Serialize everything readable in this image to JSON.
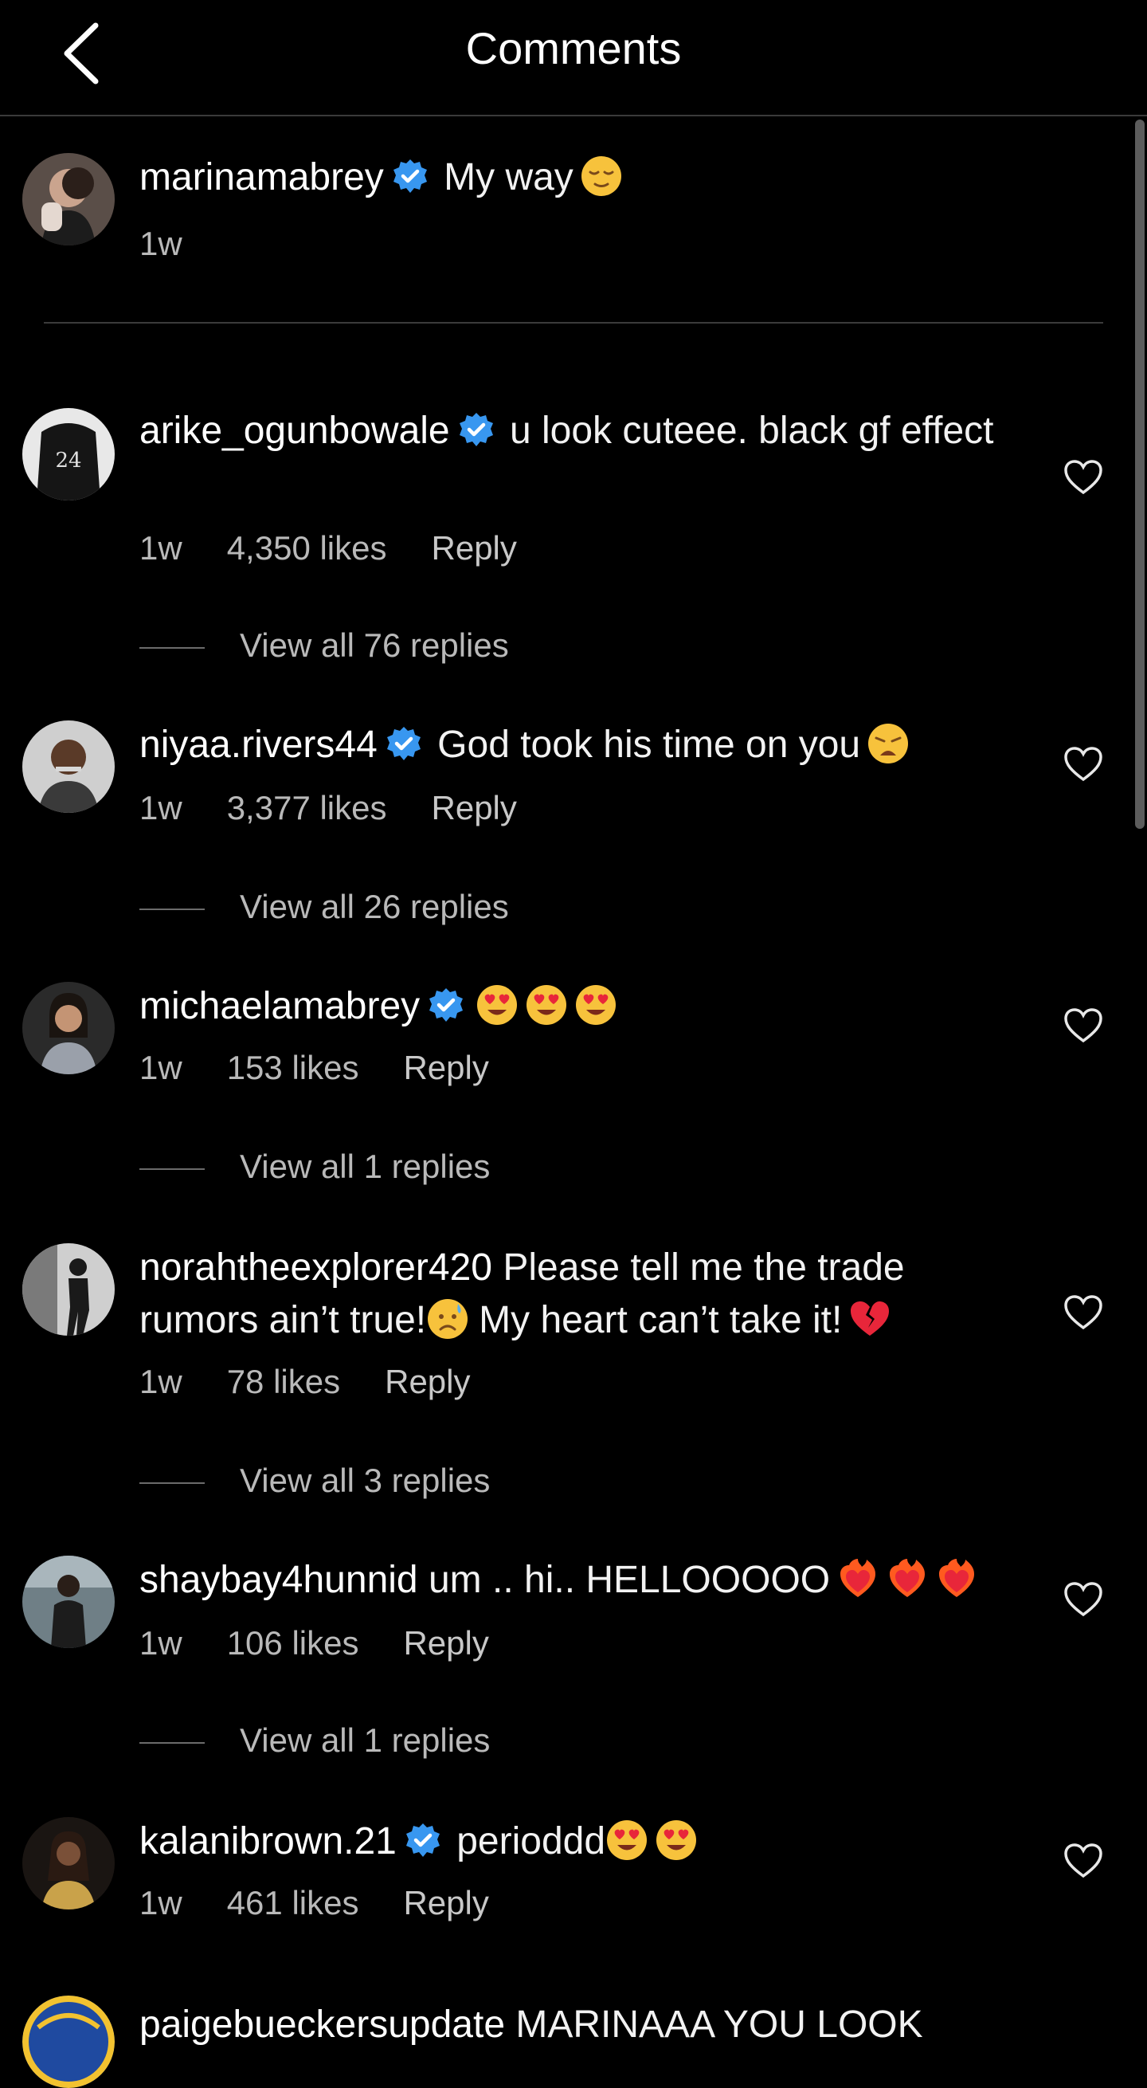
{
  "header": {
    "title": "Comments",
    "back_icon": "chevron-left-icon"
  },
  "caption": {
    "username": "marinamabrey",
    "text": "My way",
    "time": "1w"
  },
  "comments": [
    {
      "username": "arike_ogunbowale",
      "verified": true,
      "text": "u look cuteee. black gf effect",
      "time": "1w",
      "likes": "4,350 likes",
      "reply": "Reply",
      "view_replies": "View all 76 replies",
      "avatar_jersey": "24"
    },
    {
      "username": "niyaa.rivers44",
      "verified": true,
      "text": "God took his time on you",
      "time": "1w",
      "likes": "3,377 likes",
      "reply": "Reply",
      "view_replies": "View all 26 replies"
    },
    {
      "username": "michaelamabrey",
      "verified": true,
      "text": "",
      "time": "1w",
      "likes": "153 likes",
      "reply": "Reply",
      "view_replies": "View all 1 replies"
    },
    {
      "username": "norahtheexplorer420",
      "verified": false,
      "text_line1": "Please tell me the trade",
      "text_line2a": "rumors ain’t true!",
      "text_line2b": "My heart can’t take it!",
      "time": "1w",
      "likes": "78 likes",
      "reply": "Reply",
      "view_replies": "View all 3 replies"
    },
    {
      "username": "shaybay4hunnid",
      "verified": false,
      "text": "um .. hi.. HELLOOOOO",
      "time": "1w",
      "likes": "106 likes",
      "reply": "Reply",
      "view_replies": "View all 1 replies"
    },
    {
      "username": "kalanibrown.21",
      "verified": true,
      "text": "perioddd",
      "time": "1w",
      "likes": "461 likes",
      "reply": "Reply"
    },
    {
      "username": "paigebueckersupdate",
      "verified": false,
      "text": "MARINAAA YOU LOOK"
    }
  ],
  "colors": {
    "background": "#000000",
    "verified_blue": "#3897f0",
    "text": "#f2f2f2",
    "secondary_text": "#b9b9b9"
  }
}
